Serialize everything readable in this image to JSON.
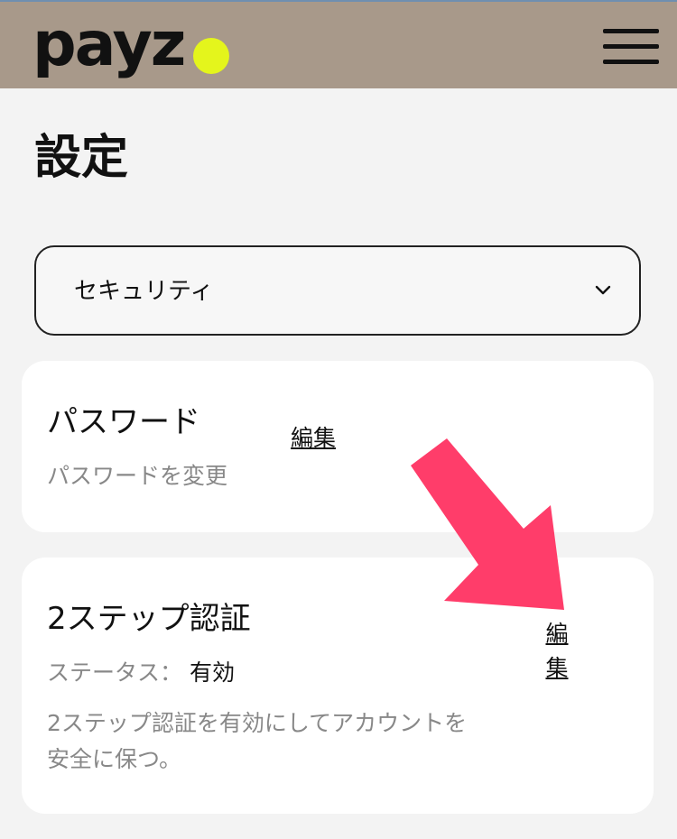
{
  "header": {
    "logo_text": "payz",
    "logo_dot_color": "#e4f51c",
    "background_color": "#a8998a",
    "menu_icon": "hamburger-menu-icon"
  },
  "page": {
    "title": "設定"
  },
  "category_select": {
    "selected_value": "セキュリティ",
    "icon": "chevron-down-icon"
  },
  "cards": {
    "password": {
      "title": "パスワード",
      "description": "パスワードを変更",
      "edit_label": "編集"
    },
    "two_step": {
      "title": "2ステップ認証",
      "status_label": "ステータス：",
      "status_value": "有効",
      "description_line1": "2ステップ認証を有効にしてアカウントを",
      "description_line2": "安全に保つ。",
      "edit_label": "編集"
    }
  },
  "annotation": {
    "icon": "red-arrow-icon",
    "color": "#ff3d6a"
  }
}
